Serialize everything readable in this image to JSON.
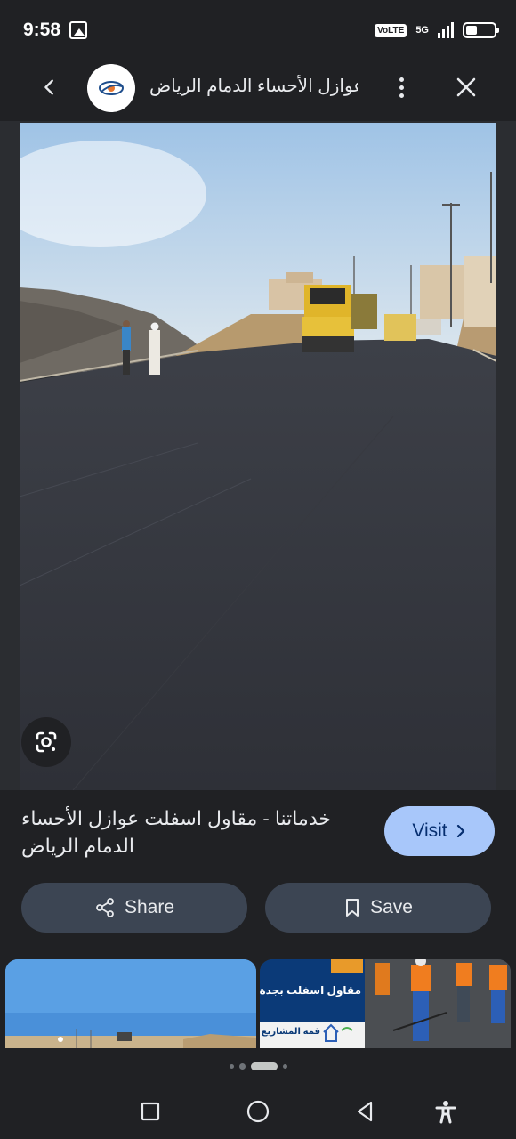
{
  "status_bar": {
    "time": "9:58",
    "volte": "VoLTE",
    "network": "5G",
    "icons": [
      "gallery-icon",
      "signal-icon",
      "battery-icon"
    ]
  },
  "app_bar": {
    "title": "عوازل الأحساء الدمام الرياض...",
    "icons": [
      "back-arrow-icon",
      "site-logo-icon",
      "more-vert-icon",
      "close-icon"
    ]
  },
  "result": {
    "caption": "خدماتنا - مقاول اسفلت عوازل الأحساء الدمام الرياض",
    "visit_label": "Visit",
    "share_label": "Share",
    "save_label": "Save"
  },
  "related": {
    "thumb2_line1": "مقاول اسفلت بجدة",
    "thumb2_line2": "قمة المشاريع"
  },
  "colors": {
    "background": "#202124",
    "visit_button": "#a8c7fa",
    "action_button": "#3c4553"
  }
}
